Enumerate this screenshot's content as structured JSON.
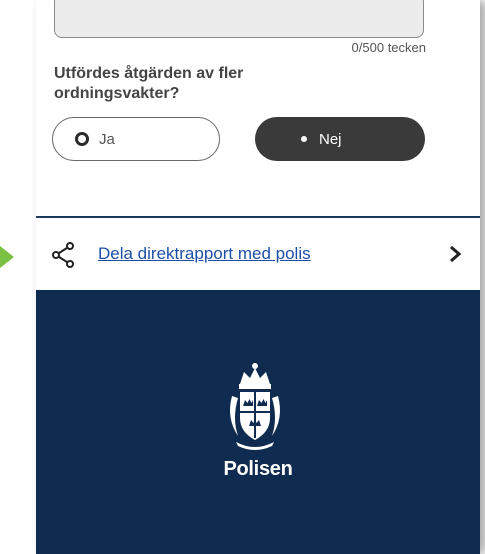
{
  "form": {
    "char_count": "0/500 tecken",
    "question": "Utfördes åtgärden av fler ordningsvakter?",
    "options": {
      "yes_label": "Ja",
      "no_label": "Nej",
      "selected": "Nej"
    }
  },
  "share": {
    "link_label": "Dela direktrapport med polis",
    "icon": "share-icon",
    "chevron_icon": "chevron-right-icon"
  },
  "footer": {
    "brand": "Polisen",
    "logo": "polisen-crest-logo"
  },
  "colors": {
    "link": "#1d4fa8",
    "footer_bg": "#0f2b4f",
    "selected_toggle": "#3a3a3a",
    "indicator_arrow": "#7ac143"
  }
}
